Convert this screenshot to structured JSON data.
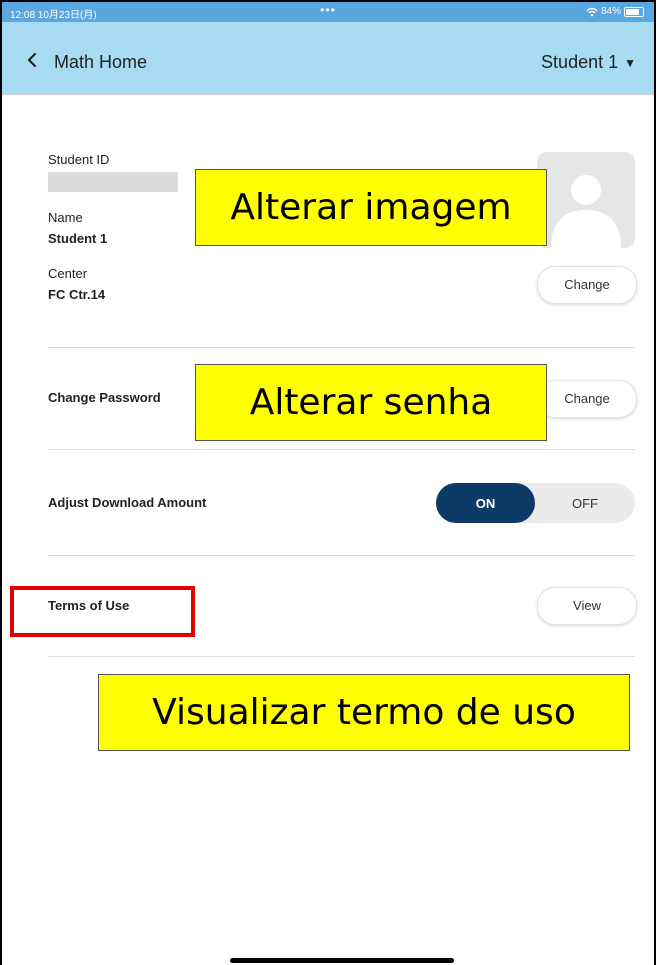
{
  "status_bar": {
    "time": "12:08 10月23日(月)",
    "dots": "•••",
    "wifi_icon": "wifi-icon",
    "battery_text": "84%",
    "battery_level": 0.84
  },
  "nav": {
    "back_icon": "chevron-left-icon",
    "title": "Math Home",
    "student_menu": "Student 1",
    "caret_icon": "caret-down-icon",
    "colors": {
      "status": "#5aa7e0",
      "navbar": "#a7dbf1"
    }
  },
  "profile": {
    "student_id_label": "Student ID",
    "name_label": "Name",
    "name_value": "Student 1",
    "center_label": "Center",
    "center_value": "FC Ctr.14",
    "avatar_icon": "user-avatar-icon",
    "center_change_button": "Change"
  },
  "password": {
    "label": "Change Password",
    "change_button": "Change"
  },
  "download": {
    "label": "Adjust Download Amount",
    "on_label": "ON",
    "off_label": "OFF",
    "selected": "ON"
  },
  "terms": {
    "label": "Terms of Use",
    "view_button": "View"
  },
  "callouts": {
    "change_image": "Alterar imagem",
    "change_password": "Alterar senha",
    "view_terms": "Visualizar termo de uso"
  }
}
